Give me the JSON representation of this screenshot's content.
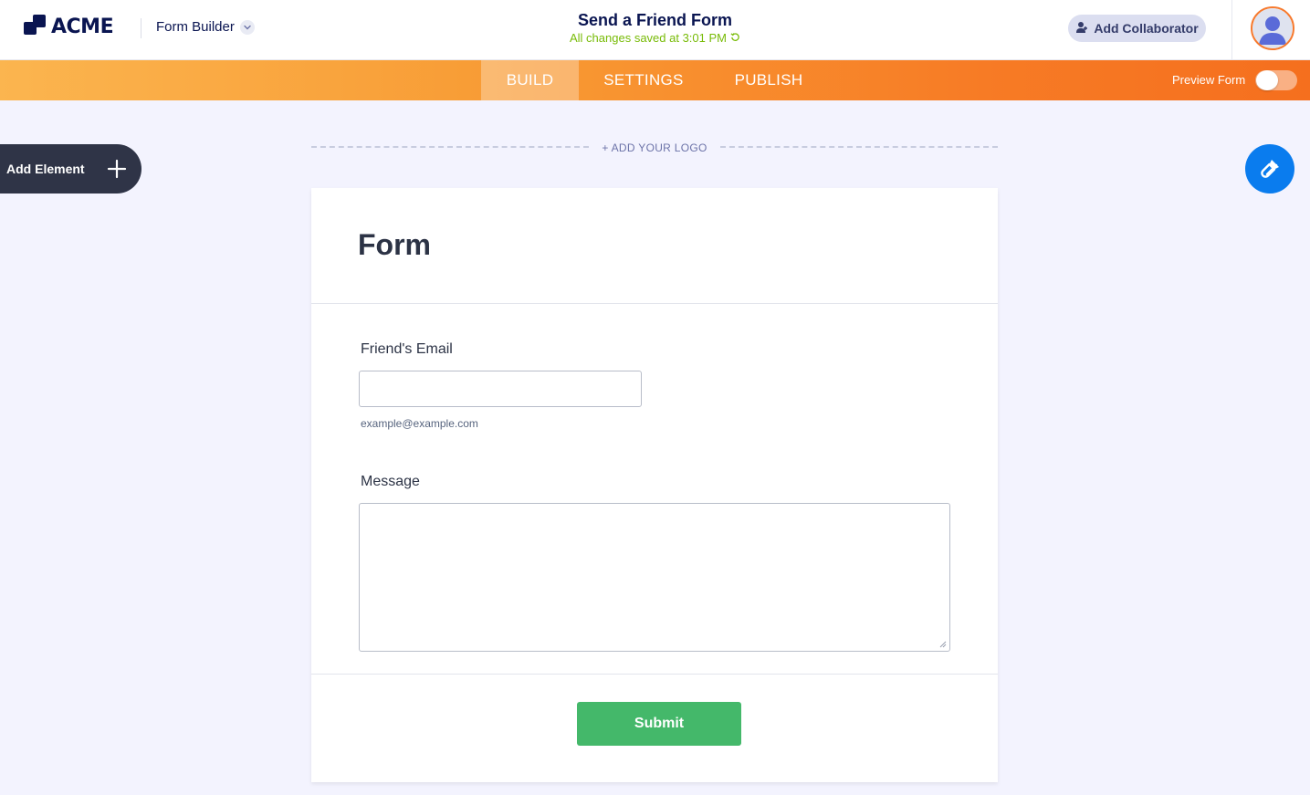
{
  "header": {
    "brand": "ACME",
    "product_switcher": "Form Builder",
    "form_title": "Send a Friend Form",
    "save_status": "All changes saved at 3:01 PM",
    "add_collaborator": "Add Collaborator"
  },
  "nav": {
    "tabs": [
      {
        "label": "BUILD",
        "active": true
      },
      {
        "label": "SETTINGS",
        "active": false
      },
      {
        "label": "PUBLISH",
        "active": false
      }
    ],
    "preview_label": "Preview Form",
    "preview_enabled": false
  },
  "builder": {
    "add_element": "Add Element",
    "add_logo": "+ ADD YOUR LOGO"
  },
  "form": {
    "heading": "Form",
    "fields": [
      {
        "label": "Friend's Email",
        "value": "",
        "sublabel": "example@example.com"
      },
      {
        "label": "Message",
        "value": ""
      }
    ],
    "submit_label": "Submit"
  },
  "colors": {
    "brand_navy": "#0a1551",
    "nav_orange_start": "#fbb54f",
    "nav_orange_end": "#f56f1e",
    "save_green": "#78bb07",
    "submit_green": "#44b86a",
    "designer_blue": "#0a7cee",
    "avatar_ring": "#f77a2e"
  },
  "icons": [
    "acme-logo-icon",
    "chevron-down-icon",
    "refresh-icon",
    "add-user-icon",
    "avatar-icon",
    "plus-icon",
    "paint-brush-icon",
    "resize-grip-icon"
  ]
}
